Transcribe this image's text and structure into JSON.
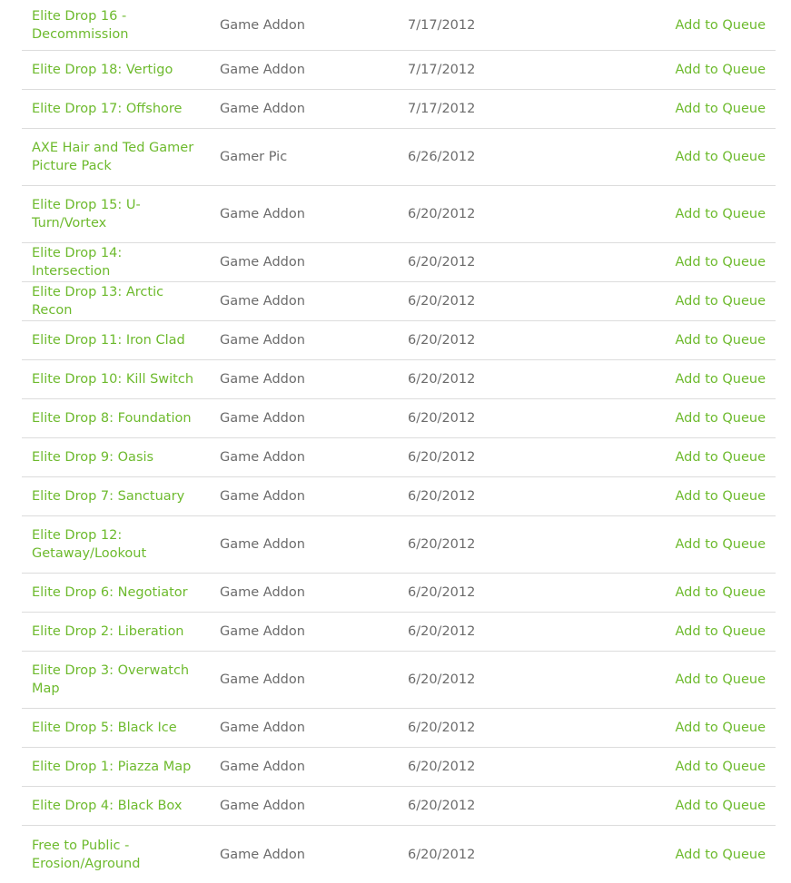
{
  "colors": {
    "link": "#6dba2d",
    "text": "#6b6b6b",
    "divider": "#dcdcdc"
  },
  "rows": [
    {
      "name": "Elite Drop 16 - Decommission",
      "type": "Game Addon",
      "date": "7/17/2012",
      "action": "Add to Queue"
    },
    {
      "name": "Elite Drop 18: Vertigo",
      "type": "Game Addon",
      "date": "7/17/2012",
      "action": "Add to Queue"
    },
    {
      "name": "Elite Drop 17: Offshore",
      "type": "Game Addon",
      "date": "7/17/2012",
      "action": "Add to Queue"
    },
    {
      "name": "AXE Hair and Ted Gamer Picture Pack",
      "type": "Gamer Pic",
      "date": "6/26/2012",
      "action": "Add to Queue"
    },
    {
      "name": "Elite Drop 15: U-Turn/Vortex",
      "type": "Game Addon",
      "date": "6/20/2012",
      "action": "Add to Queue"
    },
    {
      "name": "Elite Drop 14: Intersection",
      "type": "Game Addon",
      "date": "6/20/2012",
      "action": "Add to Queue"
    },
    {
      "name": "Elite Drop 13: Arctic Recon",
      "type": "Game Addon",
      "date": "6/20/2012",
      "action": "Add to Queue"
    },
    {
      "name": "Elite Drop 11: Iron Clad",
      "type": "Game Addon",
      "date": "6/20/2012",
      "action": "Add to Queue"
    },
    {
      "name": "Elite Drop 10: Kill Switch",
      "type": "Game Addon",
      "date": "6/20/2012",
      "action": "Add to Queue"
    },
    {
      "name": "Elite Drop 8: Foundation",
      "type": "Game Addon",
      "date": "6/20/2012",
      "action": "Add to Queue"
    },
    {
      "name": "Elite Drop 9: Oasis",
      "type": "Game Addon",
      "date": "6/20/2012",
      "action": "Add to Queue"
    },
    {
      "name": "Elite Drop 7: Sanctuary",
      "type": "Game Addon",
      "date": "6/20/2012",
      "action": "Add to Queue"
    },
    {
      "name": "Elite Drop 12: Getaway/Lookout",
      "type": "Game Addon",
      "date": "6/20/2012",
      "action": "Add to Queue"
    },
    {
      "name": "Elite Drop 6: Negotiator",
      "type": "Game Addon",
      "date": "6/20/2012",
      "action": "Add to Queue"
    },
    {
      "name": "Elite Drop 2: Liberation",
      "type": "Game Addon",
      "date": "6/20/2012",
      "action": "Add to Queue"
    },
    {
      "name": "Elite Drop 3: Overwatch Map",
      "type": "Game Addon",
      "date": "6/20/2012",
      "action": "Add to Queue"
    },
    {
      "name": "Elite Drop 5: Black Ice",
      "type": "Game Addon",
      "date": "6/20/2012",
      "action": "Add to Queue"
    },
    {
      "name": "Elite Drop 1: Piazza Map",
      "type": "Game Addon",
      "date": "6/20/2012",
      "action": "Add to Queue"
    },
    {
      "name": "Elite Drop 4: Black Box",
      "type": "Game Addon",
      "date": "6/20/2012",
      "action": "Add to Queue"
    },
    {
      "name": "Free to Public - Erosion/Aground",
      "type": "Game Addon",
      "date": "6/20/2012",
      "action": "Add to Queue"
    }
  ]
}
